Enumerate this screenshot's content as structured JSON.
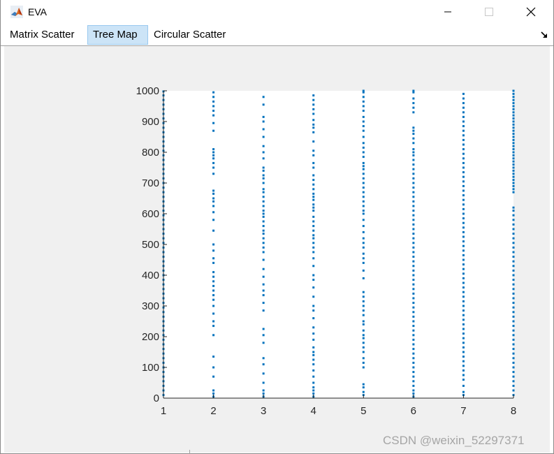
{
  "window": {
    "title": "EVA",
    "accent": "#0072bd"
  },
  "titlebar_buttons": {
    "minimize": "minimize-icon",
    "maximize": "maximize-icon",
    "close": "close-icon"
  },
  "tabs": [
    {
      "label": "Matrix Scatter",
      "selected": false
    },
    {
      "label": "Tree Map",
      "selected": true
    },
    {
      "label": "Circular Scatter",
      "selected": false
    }
  ],
  "watermark": "CSDN @weixin_52297371",
  "chart_data": {
    "type": "scatter",
    "title": "",
    "xlabel": "",
    "ylabel": "",
    "xlim": [
      1,
      8
    ],
    "ylim": [
      0,
      1000
    ],
    "xticks": [
      "1",
      "2",
      "3",
      "4",
      "5",
      "6",
      "7",
      "8"
    ],
    "yticks": [
      "0",
      "100",
      "200",
      "300",
      "400",
      "500",
      "600",
      "700",
      "800",
      "900",
      "1000"
    ],
    "grid": false,
    "marker_color": "#0072bd",
    "series": [
      {
        "x": 1,
        "y": [
          10,
          25,
          40,
          55,
          70,
          85,
          100,
          115,
          130,
          145,
          160,
          175,
          190,
          205,
          220,
          235,
          250,
          265,
          280,
          295,
          310,
          325,
          340,
          355,
          370,
          385,
          400,
          415,
          430,
          445,
          460,
          475,
          490,
          505,
          520,
          535,
          550,
          565,
          580,
          595,
          610,
          625,
          640,
          655,
          670,
          685,
          700,
          715,
          730,
          745,
          760,
          775,
          790,
          805,
          820,
          835,
          850,
          865,
          880,
          895,
          910,
          925,
          940,
          955,
          970,
          985,
          998
        ]
      },
      {
        "x": 2,
        "y": [
          5,
          15,
          25,
          70,
          100,
          135,
          205,
          235,
          250,
          275,
          300,
          320,
          335,
          350,
          365,
          380,
          395,
          410,
          440,
          455,
          480,
          500,
          545,
          580,
          605,
          625,
          640,
          650,
          665,
          675,
          730,
          750,
          765,
          780,
          790,
          800,
          810,
          870,
          895,
          920,
          935,
          950,
          965,
          980,
          995
        ]
      },
      {
        "x": 3,
        "y": [
          5,
          15,
          25,
          50,
          80,
          110,
          130,
          180,
          205,
          225,
          285,
          310,
          335,
          350,
          370,
          395,
          420,
          450,
          475,
          490,
          505,
          520,
          535,
          545,
          560,
          575,
          590,
          600,
          610,
          625,
          640,
          655,
          670,
          680,
          700,
          715,
          725,
          740,
          750,
          780,
          800,
          820,
          850,
          875,
          900,
          915,
          955,
          980
        ]
      },
      {
        "x": 4,
        "y": [
          5,
          15,
          25,
          35,
          50,
          70,
          90,
          110,
          125,
          140,
          150,
          165,
          190,
          210,
          230,
          260,
          285,
          300,
          330,
          360,
          385,
          400,
          430,
          455,
          475,
          490,
          505,
          520,
          530,
          545,
          560,
          575,
          590,
          610,
          620,
          630,
          645,
          655,
          665,
          680,
          695,
          710,
          725,
          750,
          765,
          790,
          805,
          835,
          865,
          880,
          890,
          905,
          925,
          940,
          955,
          970,
          985
        ]
      },
      {
        "x": 5,
        "y": [
          10,
          20,
          35,
          45,
          100,
          115,
          130,
          150,
          165,
          180,
          195,
          205,
          220,
          240,
          250,
          270,
          285,
          300,
          315,
          330,
          345,
          390,
          415,
          440,
          455,
          470,
          490,
          505,
          520,
          540,
          560,
          580,
          600,
          610,
          625,
          640,
          655,
          670,
          685,
          700,
          715,
          730,
          745,
          755,
          765,
          785,
          800,
          815,
          830,
          850,
          870,
          885,
          900,
          915,
          935,
          950,
          965,
          980,
          995,
          1000
        ]
      },
      {
        "x": 6,
        "y": [
          5,
          15,
          25,
          40,
          55,
          70,
          85,
          100,
          115,
          130,
          145,
          160,
          175,
          190,
          205,
          220,
          235,
          250,
          265,
          280,
          295,
          310,
          325,
          340,
          355,
          370,
          385,
          400,
          415,
          430,
          445,
          460,
          475,
          490,
          505,
          520,
          535,
          550,
          565,
          580,
          595,
          610,
          625,
          640,
          655,
          670,
          685,
          700,
          715,
          730,
          745,
          760,
          775,
          790,
          800,
          810,
          830,
          845,
          860,
          870,
          880,
          930,
          945,
          960,
          975,
          995,
          1000
        ]
      },
      {
        "x": 7,
        "y": [
          10,
          20,
          40,
          60,
          75,
          90,
          105,
          120,
          135,
          150,
          165,
          180,
          195,
          210,
          225,
          240,
          255,
          270,
          285,
          300,
          315,
          330,
          345,
          360,
          375,
          390,
          405,
          420,
          435,
          450,
          465,
          480,
          495,
          510,
          525,
          540,
          555,
          570,
          585,
          600,
          615,
          630,
          645,
          660,
          675,
          690,
          705,
          720,
          735,
          750,
          765,
          780,
          795,
          810,
          825,
          840,
          855,
          870,
          885,
          900,
          915,
          930,
          945,
          960,
          975,
          990
        ]
      },
      {
        "x": 8,
        "y": [
          10,
          25,
          40,
          55,
          70,
          85,
          100,
          115,
          130,
          145,
          160,
          175,
          190,
          205,
          220,
          235,
          250,
          265,
          280,
          295,
          310,
          325,
          340,
          355,
          370,
          385,
          400,
          415,
          430,
          445,
          460,
          475,
          490,
          505,
          520,
          535,
          550,
          565,
          580,
          595,
          610,
          620,
          670,
          680,
          690,
          700,
          710,
          720,
          730,
          740,
          750,
          760,
          770,
          780,
          790,
          800,
          810,
          820,
          830,
          840,
          850,
          860,
          870,
          880,
          890,
          900,
          910,
          920,
          930,
          940,
          950,
          960,
          970,
          980,
          990,
          1000
        ]
      }
    ]
  }
}
